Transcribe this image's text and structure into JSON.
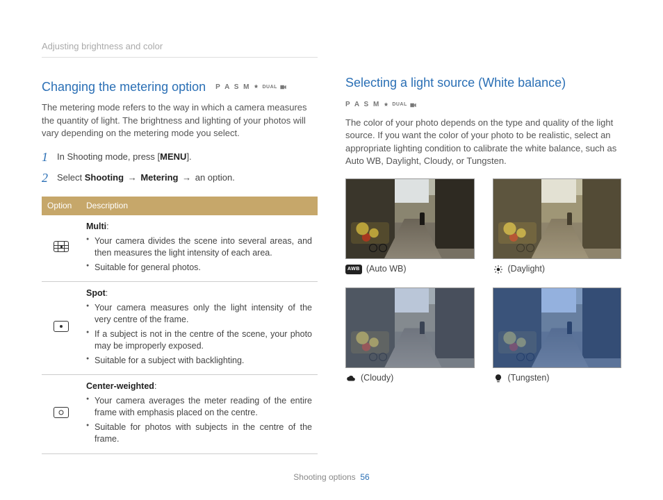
{
  "header": {
    "breadcrumb": "Adjusting brightness and color"
  },
  "footer": {
    "section": "Shooting options",
    "page": "56"
  },
  "modes": {
    "letters": "P A S M",
    "dual": "DUAL"
  },
  "left": {
    "title": "Changing the metering option",
    "intro": "The metering mode refers to the way in which a camera measures the quantity of light. The brightness and lighting of your photos will vary depending on the metering mode you select.",
    "steps": {
      "s1_a": "In Shooting mode, press [",
      "s1_menu": "MENU",
      "s1_b": "].",
      "s2_a": "Select ",
      "s2_shoot": "Shooting",
      "s2_arrow1": " → ",
      "s2_meter": "Metering",
      "s2_arrow2": " → ",
      "s2_b": "an option."
    },
    "table": {
      "h_option": "Option",
      "h_desc": "Description",
      "rows": [
        {
          "title": "Multi",
          "bullets": [
            "Your camera divides the scene into several areas, and then measures the light intensity of each area.",
            "Suitable for general photos."
          ]
        },
        {
          "title": "Spot",
          "bullets": [
            "Your camera measures only the light intensity of the very centre of the frame.",
            "If a subject is not in the centre of the scene, your photo may be improperly exposed.",
            "Suitable for a subject with backlighting."
          ]
        },
        {
          "title": "Center-weighted",
          "bullets": [
            "Your camera averages the meter reading of the entire frame with emphasis placed on the centre.",
            "Suitable for photos with subjects in the centre of the frame."
          ]
        }
      ]
    }
  },
  "right": {
    "title": "Selecting a light source (White balance)",
    "intro": "The color of your photo depends on the type and quality of the light source. If you want the color of your photo to be realistic, select an appropriate lighting condition to calibrate the white balance, such as Auto WB, Daylight, Cloudy, or Tungsten.",
    "wb": {
      "awb_badge": "AWB",
      "items": [
        {
          "label": "Auto WB"
        },
        {
          "label": "Daylight"
        },
        {
          "label": "Cloudy"
        },
        {
          "label": "Tungsten"
        }
      ]
    }
  }
}
